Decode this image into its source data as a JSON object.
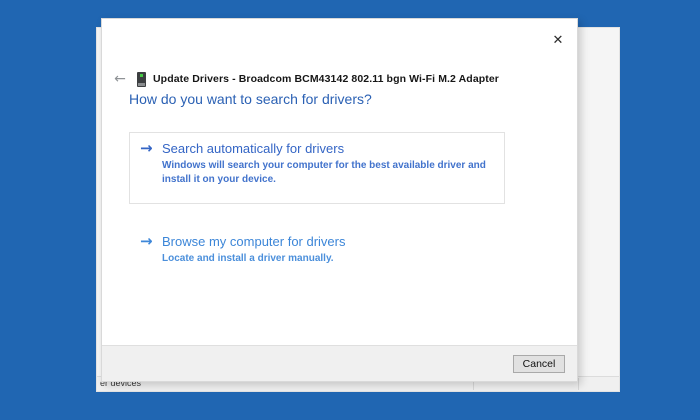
{
  "background_window": {
    "status_text": "er devices"
  },
  "dialog": {
    "title": "Update Drivers - Broadcom BCM43142 802.11 bgn Wi-Fi M.2 Adapter",
    "heading": "How do you want to search for drivers?",
    "icons": {
      "back_glyph": "←",
      "close_glyph": "✕",
      "option_arrow_glyph": "→"
    },
    "options": [
      {
        "title": "Search automatically for drivers",
        "description": "Windows will search your computer for the best available driver and install it on your device."
      },
      {
        "title": "Browse my computer for drivers",
        "description": "Locate and install a driver manually."
      }
    ],
    "footer": {
      "cancel_label": "Cancel"
    }
  },
  "colors": {
    "desktop_background": "#2066b2",
    "dialog_background": "#ffffff",
    "heading_text": "#2b61b4",
    "option1_title": "#3465c5",
    "option1_description": "#4273cc",
    "option2_title": "#3c86d8",
    "option2_description": "#4b8fdb",
    "option1_border": "#e2e2e2",
    "footer_background": "#f0f0f0",
    "cancel_button_background": "#e1e1e1",
    "cancel_button_border": "#a9a9a9",
    "device_icon_led": "#45c945"
  }
}
